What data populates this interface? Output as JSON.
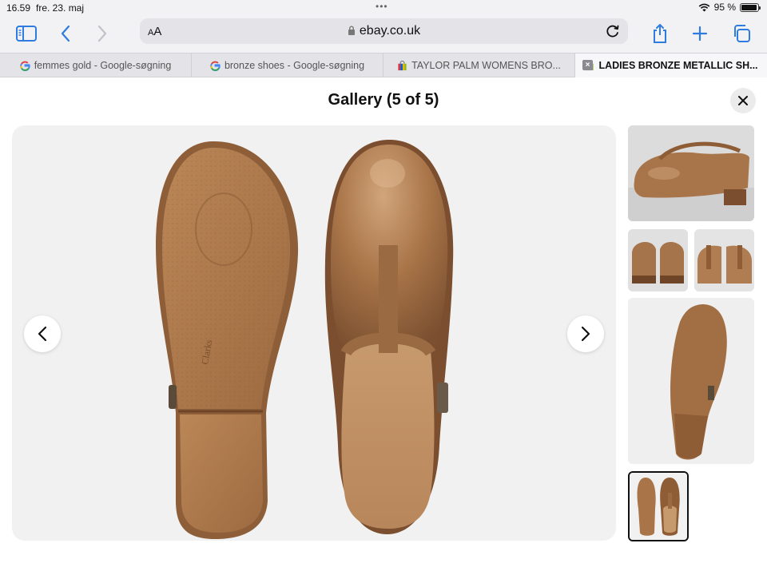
{
  "status": {
    "time": "16.59",
    "date": "fre. 23. maj",
    "battery": "95 %",
    "battery_level": 0.95
  },
  "toolbar": {
    "aa_small": "A",
    "aa_large": "A",
    "url": "ebay.co.uk"
  },
  "tabs": [
    {
      "label": "femmes gold - Google-søgning",
      "favicon": "google-icon"
    },
    {
      "label": "bronze shoes - Google-søgning",
      "favicon": "google-icon"
    },
    {
      "label": "TAYLOR PALM WOMENS BRO...",
      "favicon": "ebay-bag-icon"
    },
    {
      "label": "LADIES BRONZE METALLIC SH...",
      "favicon": "ebay-bag-icon",
      "active": true
    }
  ],
  "gallery": {
    "title": "Gallery (5 of 5)",
    "current_index": 5,
    "total": 5
  },
  "colors": {
    "accent": "#2f7ce0",
    "leather": "#a5754c",
    "sole": "#b27a4f"
  }
}
